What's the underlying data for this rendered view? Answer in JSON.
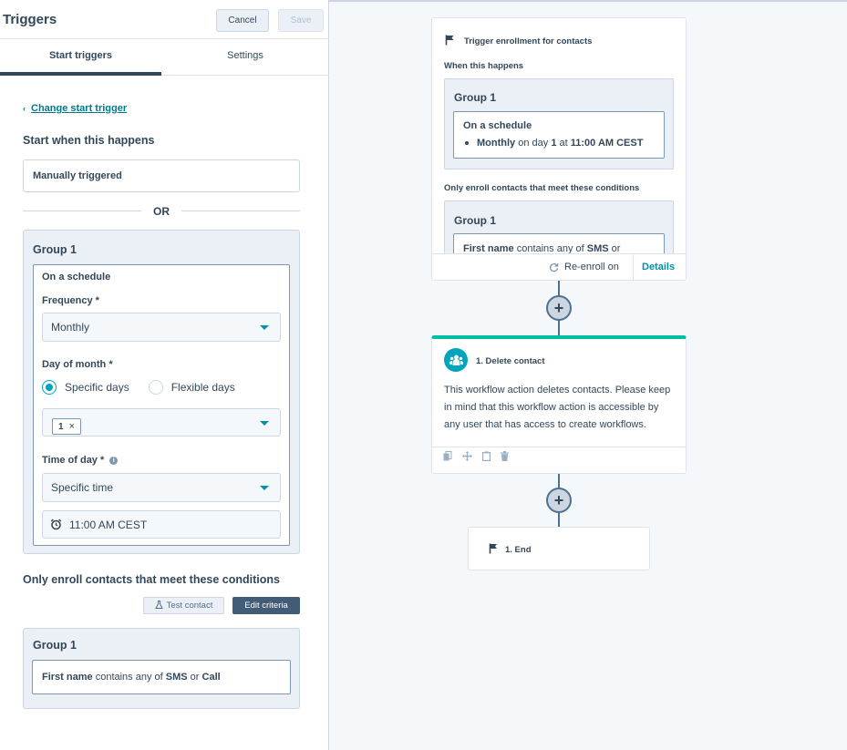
{
  "panel": {
    "title": "Triggers",
    "cancel_label": "Cancel",
    "save_label": "Save",
    "tabs": [
      {
        "label": "Start triggers",
        "active": true
      },
      {
        "label": "Settings",
        "active": false
      }
    ],
    "change_trigger_chevron": "‹",
    "change_trigger_label": "Change start trigger",
    "start_heading": "Start when this happens",
    "manual_trigger_value": "Manually triggered",
    "or_label": "OR",
    "group": {
      "title": "Group 1",
      "schedule_title": "On a schedule",
      "frequency_label": "Frequency *",
      "frequency_value": "Monthly",
      "day_of_month_label": "Day of month *",
      "radio_specific": "Specific days",
      "radio_flexible": "Flexible days",
      "selected_day_chip": "1",
      "chip_remove": "×",
      "time_of_day_label": "Time of day *",
      "time_mode_value": "Specific time",
      "time_value": "11:00 AM CEST"
    },
    "conditions_heading": "Only enroll contacts that meet these conditions",
    "test_contact_label": "Test contact",
    "edit_criteria_label": "Edit criteria",
    "group2": {
      "title": "Group 1",
      "field": "First name",
      "operator": "contains any of",
      "value1": "SMS",
      "joiner": "or",
      "value2": "Call"
    }
  },
  "canvas": {
    "trigger_card": {
      "title": "Trigger enrollment for contacts",
      "when_label": "When this happens",
      "group_title": "Group 1",
      "schedule_title": "On a schedule",
      "schedule_freq": "Monthly",
      "schedule_on_day": "on day",
      "schedule_day": "1",
      "schedule_at": "at",
      "schedule_time": "11:00 AM CEST",
      "conditions_label": "Only enroll contacts that meet these conditions",
      "cond_group_title": "Group 1",
      "cond_field": "First name",
      "cond_operator": "contains any of",
      "cond_value": "SMS",
      "cond_joiner": "or",
      "reenroll_label": "Re-enroll on",
      "details_label": "Details"
    },
    "action_card": {
      "title": "1. Delete contact",
      "description": "This workflow action deletes contacts. Please keep in mind that this workflow action is accessible by any user that has access to create workflows."
    },
    "end_card": {
      "title": "1. End"
    }
  },
  "colors": {
    "accent": "#00a4bd",
    "link": "#007a8c",
    "action_border": "#00bda5",
    "primary_dark": "#425b76"
  }
}
